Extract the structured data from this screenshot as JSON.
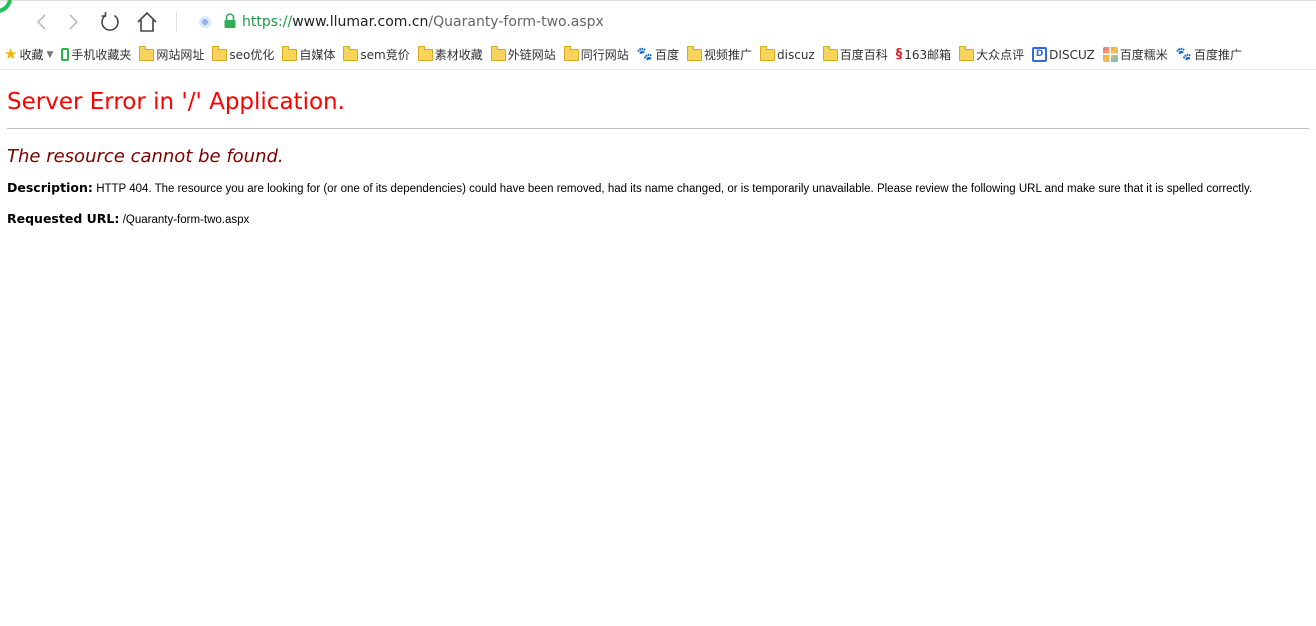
{
  "toolbar": {
    "url_scheme": "https://",
    "url_host": "www.llumar.com.cn",
    "url_path": "/Quaranty-form-two.aspx"
  },
  "bookmarks": [
    {
      "label": "收藏",
      "icon": "star-icon",
      "name": "bookmark-favorites"
    },
    {
      "label": "手机收藏夹",
      "icon": "phone-icon",
      "name": "bookmark-mobile-favorites"
    },
    {
      "label": "网站网址",
      "icon": "folder-icon",
      "name": "bookmark-websites"
    },
    {
      "label": "seo优化",
      "icon": "folder-icon",
      "name": "bookmark-seo"
    },
    {
      "label": "自媒体",
      "icon": "folder-icon",
      "name": "bookmark-self-media"
    },
    {
      "label": "sem竞价",
      "icon": "folder-icon",
      "name": "bookmark-sem"
    },
    {
      "label": "素材收藏",
      "icon": "folder-icon",
      "name": "bookmark-materials"
    },
    {
      "label": "外链网站",
      "icon": "folder-icon",
      "name": "bookmark-external-links"
    },
    {
      "label": "同行网站",
      "icon": "folder-icon",
      "name": "bookmark-peer-sites"
    },
    {
      "label": "百度",
      "icon": "paw-icon",
      "name": "bookmark-baidu"
    },
    {
      "label": "视频推广",
      "icon": "folder-icon",
      "name": "bookmark-video-promo"
    },
    {
      "label": "discuz",
      "icon": "folder-icon",
      "name": "bookmark-discuz-folder"
    },
    {
      "label": "百度百科",
      "icon": "folder-icon",
      "name": "bookmark-baidu-baike"
    },
    {
      "label": "163邮箱",
      "icon": "mail-163-icon",
      "name": "bookmark-163-mail"
    },
    {
      "label": "大众点评",
      "icon": "folder-icon",
      "name": "bookmark-dianping"
    },
    {
      "label": "DISCUZ",
      "icon": "discuz-icon",
      "name": "bookmark-discuz"
    },
    {
      "label": "百度糯米",
      "icon": "grid-icon",
      "name": "bookmark-baidu-nuomi"
    },
    {
      "label": "百度推广",
      "icon": "paw-icon",
      "name": "bookmark-baidu-promo"
    }
  ],
  "page": {
    "title": "Server Error in '/' Application.",
    "subtitle": "The resource cannot be found.",
    "description_label": "Description:",
    "description_text": "HTTP 404. The resource you are looking for (or one of its dependencies) could have been removed, had its name changed, or is temporarily unavailable.  Please review the following URL and make sure that it is spelled correctly.",
    "requested_label": "Requested URL:",
    "requested_value": "/Quaranty-form-two.aspx"
  },
  "colors": {
    "title": "#ff0000",
    "subtitle": "#800000",
    "secure_url": "#1a9c44"
  }
}
